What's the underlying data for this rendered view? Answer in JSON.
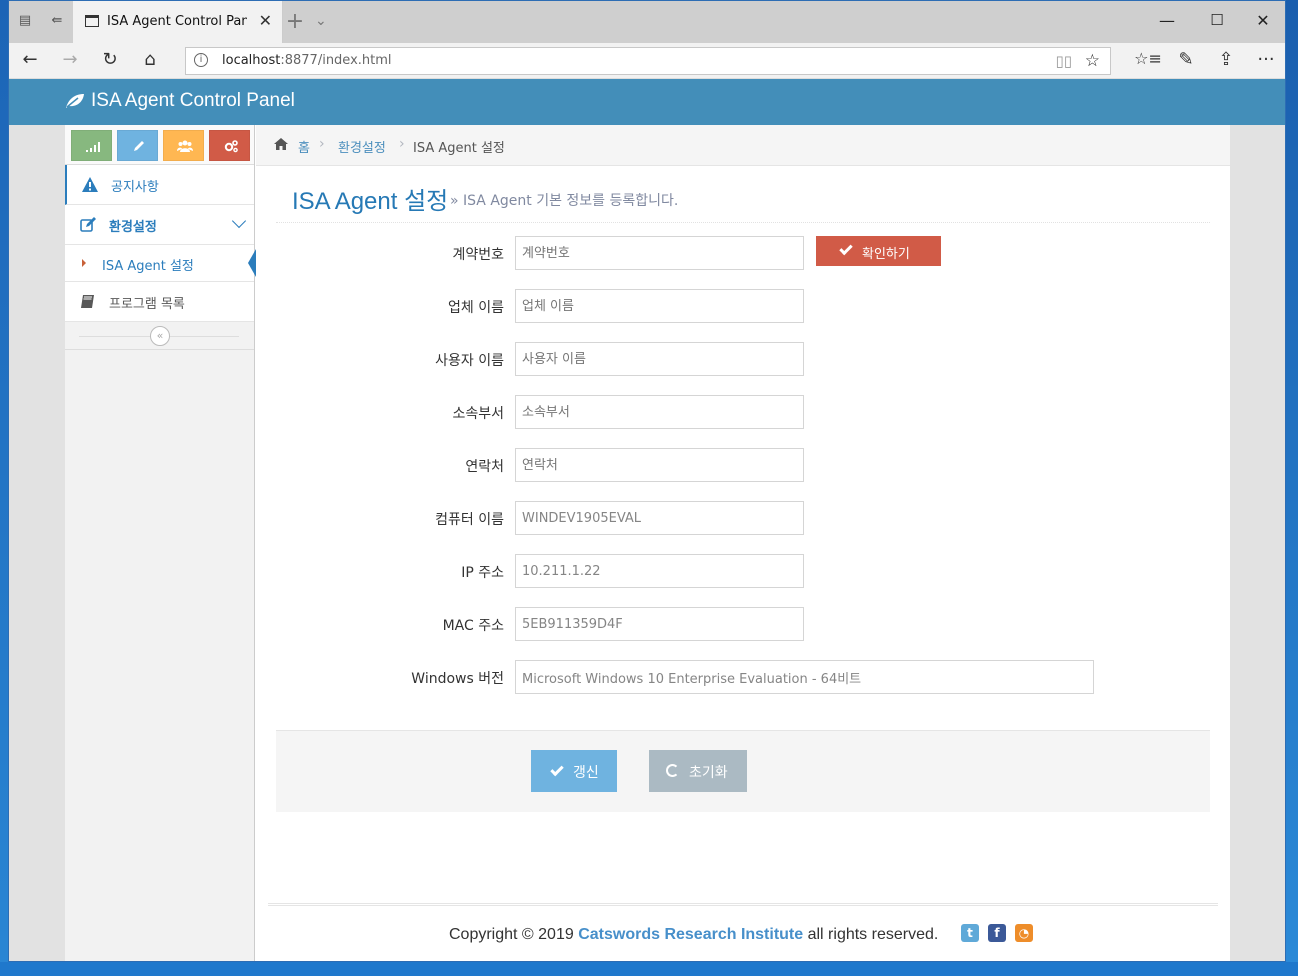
{
  "browser": {
    "tab_title": "ISA Agent Control Pane",
    "url_host": "localhost",
    "url_rest": ":8877/index.html"
  },
  "app": {
    "title": "ISA Agent Control Panel"
  },
  "sidebar": {
    "shortcut_colors": [
      "#87b87f",
      "#6fb3e0",
      "#ffb752",
      "#d15b47"
    ],
    "items": {
      "notice": "공지사항",
      "settings": "환경설정",
      "isa_settings": "ISA Agent 설정",
      "programs": "프로그램 목록"
    }
  },
  "breadcrumb": {
    "home": "홈",
    "settings": "환경설정",
    "current": "ISA Agent 설정"
  },
  "page": {
    "title": "ISA Agent 설정",
    "subtitle": "» ISA Agent 기본 정보를 등록합니다."
  },
  "form": {
    "contract_label": "계약번호",
    "contract_placeholder": "계약번호",
    "confirm_button": "확인하기",
    "company_label": "업체 이름",
    "company_placeholder": "업체 이름",
    "user_label": "사용자 이름",
    "user_placeholder": "사용자 이름",
    "dept_label": "소속부서",
    "dept_placeholder": "소속부서",
    "contact_label": "연락처",
    "contact_placeholder": "연락처",
    "computer_label": "컴퓨터 이름",
    "computer_value": "WINDEV1905EVAL",
    "ip_label": "IP 주소",
    "ip_value": "10.211.1.22",
    "mac_label": "MAC 주소",
    "mac_value": "5EB911359D4F",
    "windows_label": "Windows 버전",
    "windows_value": "Microsoft Windows 10 Enterprise Evaluation - 64비트"
  },
  "actions": {
    "update": "갱신",
    "reset": "초기화"
  },
  "footer": {
    "prefix": "Copyright © 2019 ",
    "org": "Catswords Research Institute",
    "suffix": " all rights reserved."
  },
  "colors": {
    "header_blue": "#438eb9",
    "danger": "#d15b47",
    "info": "#6fb3e0",
    "grey": "#abbac3"
  }
}
